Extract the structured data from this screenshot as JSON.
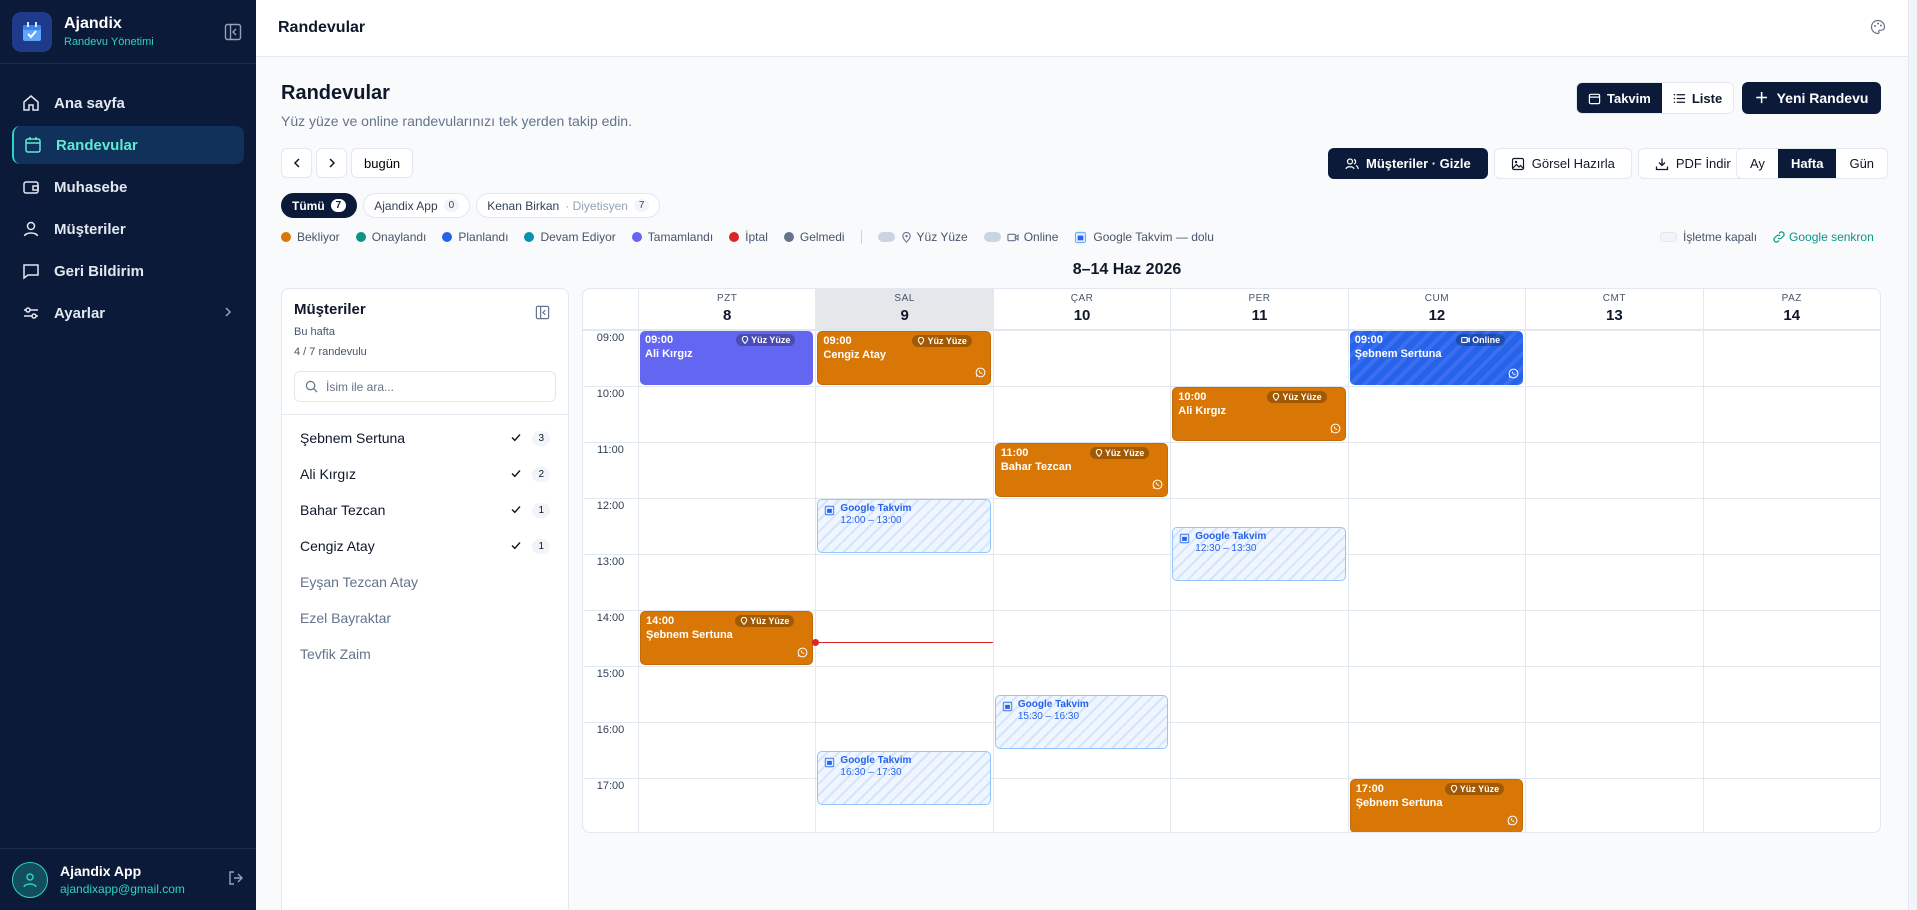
{
  "brand": {
    "title": "Ajandix",
    "subtitle": "Randevu Yönetimi"
  },
  "sidebar": {
    "items": [
      {
        "label": "Ana sayfa",
        "icon": "home-icon"
      },
      {
        "label": "Randevular",
        "icon": "calendar-icon",
        "active": true
      },
      {
        "label": "Muhasebe",
        "icon": "wallet-icon"
      },
      {
        "label": "Müşteriler",
        "icon": "user-icon"
      },
      {
        "label": "Geri Bildirim",
        "icon": "message-icon"
      },
      {
        "label": "Ayarlar",
        "icon": "settings-icon"
      }
    ]
  },
  "user": {
    "name": "Ajandix App",
    "email": "ajandixapp@gmail.com"
  },
  "topbar": {
    "title": "Randevular"
  },
  "page": {
    "title": "Randevular",
    "subtitle": "Yüz yüze ve online randevularınızı tek yerden takip edin.",
    "view_calendar": "Takvim",
    "view_list": "Liste",
    "new_button": "Yeni Randevu",
    "today": "bugün",
    "tool_customers": "Müşteriler · Gizle",
    "tool_visual": "Görsel Hazırla",
    "tool_pdf": "PDF İndir",
    "range_month": "Ay",
    "range_week": "Hafta",
    "range_day": "Gün",
    "week_title": "8–14 Haz 2026"
  },
  "filters": [
    {
      "label": "Tümü",
      "count": "7",
      "active": true
    },
    {
      "label": "Ajandix App",
      "count": "0"
    },
    {
      "label": "Kenan Birkan",
      "suffix": "· Diyetisyen",
      "count": "7"
    }
  ],
  "legend": {
    "statuses": [
      {
        "label": "Bekliyor",
        "color": "#d97706"
      },
      {
        "label": "Onaylandı",
        "color": "#0d9488"
      },
      {
        "label": "Planlandı",
        "color": "#2563eb"
      },
      {
        "label": "Devam Ediyor",
        "color": "#0891b2"
      },
      {
        "label": "Tamamlandı",
        "color": "#6366f1"
      },
      {
        "label": "İptal",
        "color": "#dc2626"
      },
      {
        "label": "Gelmedi",
        "color": "#64748b"
      }
    ],
    "face_to_face": "Yüz Yüze",
    "online": "Online",
    "google_full": "Google Takvim — dolu",
    "closed": "İşletme kapalı",
    "sync": "Google senkron"
  },
  "customers": {
    "title": "Müşteriler",
    "period": "Bu hafta",
    "summary": "4 / 7 randevulu",
    "search_placeholder": "İsim ile ara...",
    "list": [
      {
        "name": "Şebnem Sertuna",
        "count": "3"
      },
      {
        "name": "Ali Kırgız",
        "count": "2"
      },
      {
        "name": "Bahar Tezcan",
        "count": "1"
      },
      {
        "name": "Cengiz Atay",
        "count": "1"
      },
      {
        "name": "Eyşan Tezcan Atay"
      },
      {
        "name": "Ezel Bayraktar"
      },
      {
        "name": "Tevfik Zaim"
      }
    ]
  },
  "calendar": {
    "days": [
      {
        "name": "PZT",
        "date": "8"
      },
      {
        "name": "SAL",
        "date": "9",
        "today": true
      },
      {
        "name": "ÇAR",
        "date": "10"
      },
      {
        "name": "PER",
        "date": "11"
      },
      {
        "name": "CUM",
        "date": "12"
      },
      {
        "name": "CMT",
        "date": "13"
      },
      {
        "name": "PAZ",
        "date": "14"
      }
    ],
    "hours": [
      "09:00",
      "10:00",
      "11:00",
      "12:00",
      "13:00",
      "14:00",
      "15:00",
      "16:00",
      "17:00"
    ],
    "events": [
      {
        "day": 0,
        "start": 9,
        "end": 10,
        "time": "09:00",
        "name": "Ali Kırgız",
        "tag": "Yüz Yüze",
        "style": "purple",
        "whatsapp": false
      },
      {
        "day": 1,
        "start": 9,
        "end": 10,
        "time": "09:00",
        "name": "Cengiz Atay",
        "tag": "Yüz Yüze",
        "style": "orange",
        "whatsapp": true
      },
      {
        "day": 4,
        "start": 9,
        "end": 10,
        "time": "09:00",
        "name": "Şebnem Sertuna",
        "tag": "Online",
        "style": "blue",
        "whatsapp": true
      },
      {
        "day": 3,
        "start": 10,
        "end": 11,
        "time": "10:00",
        "name": "Ali Kırgız",
        "tag": "Yüz Yüze",
        "style": "orange",
        "whatsapp": true
      },
      {
        "day": 2,
        "start": 11,
        "end": 12,
        "time": "11:00",
        "name": "Bahar Tezcan",
        "tag": "Yüz Yüze",
        "style": "orange",
        "whatsapp": true
      },
      {
        "day": 0,
        "start": 14,
        "end": 15,
        "time": "14:00",
        "name": "Şebnem Sertuna",
        "tag": "Yüz Yüze",
        "style": "orange",
        "whatsapp": true
      },
      {
        "day": 4,
        "start": 17,
        "end": 18,
        "time": "17:00",
        "name": "Şebnem Sertuna",
        "tag": "Yüz Yüze",
        "style": "orange",
        "whatsapp": true
      }
    ],
    "google_blocks": [
      {
        "day": 1,
        "start": 12,
        "end": 13,
        "title": "Google Takvim",
        "range": "12:00 – 13:00"
      },
      {
        "day": 3,
        "start": 12.5,
        "end": 13.5,
        "title": "Google Takvim",
        "range": "12:30 – 13:30"
      },
      {
        "day": 2,
        "start": 15.5,
        "end": 16.5,
        "title": "Google Takvim",
        "range": "15:30 – 16:30"
      },
      {
        "day": 1,
        "start": 16.5,
        "end": 17.5,
        "title": "Google Takvim",
        "range": "16:30 – 17:30"
      }
    ],
    "now": {
      "day": 1,
      "hour": 14.57
    }
  },
  "colors": {
    "navy": "#0c1a3a",
    "teal": "#2dd4bf",
    "orange": "#d97706",
    "purple": "#6366f1",
    "blue": "#2563eb"
  }
}
